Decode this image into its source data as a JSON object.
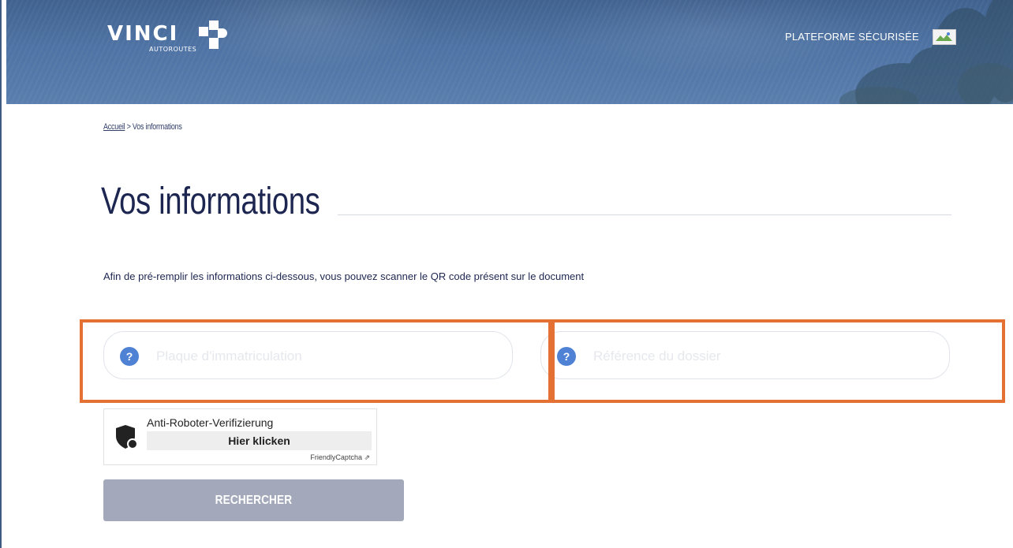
{
  "header": {
    "logo_text": "VINCI",
    "logo_subtext": "AUTOROUTES",
    "secure_label": "PLATEFORME SÉCURISÉE"
  },
  "breadcrumb": {
    "home_label": "Accueil",
    "separator": ">",
    "current_label": "Vos informations"
  },
  "page": {
    "title": "Vos informations",
    "intro": "Afin de pré-remplir les informations ci-dessous, vous pouvez scanner le QR code présent sur le document"
  },
  "form": {
    "plate_placeholder": "Plaque d'immatriculation",
    "plate_help_icon": "?",
    "reference_placeholder": "Référence du dossier",
    "reference_help_icon": "?"
  },
  "captcha": {
    "label": "Anti-Roboter-Verifizierung",
    "button_label": "Hier klicken",
    "brand": "FriendlyCaptcha ⇗"
  },
  "actions": {
    "search_label": "RECHERCHER"
  },
  "colors": {
    "header_blue": "#4e73a4",
    "title_navy": "#1d2650",
    "help_icon_blue": "#4f82d4",
    "highlight_orange": "#e57033",
    "button_disabled": "#a3a9ba"
  }
}
